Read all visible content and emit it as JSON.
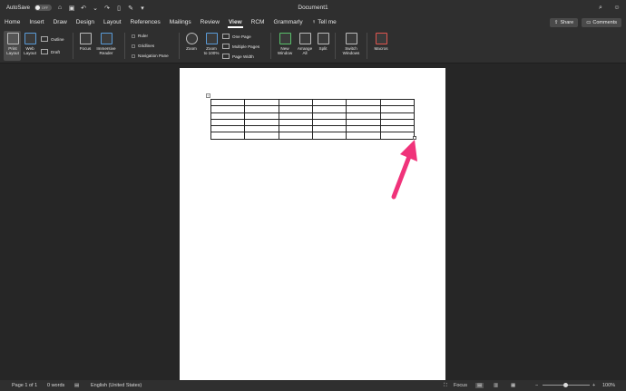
{
  "titlebar": {
    "autosave_label": "AutoSave",
    "autosave_state": "OFF",
    "document_title": "Document1"
  },
  "tabs": [
    "Home",
    "Insert",
    "Draw",
    "Design",
    "Layout",
    "References",
    "Mailings",
    "Review",
    "View",
    "RCM",
    "Grammarly"
  ],
  "active_tab": "View",
  "tell_me": "Tell me",
  "share_label": "Share",
  "comments_label": "Comments",
  "ribbon": {
    "print_layout": [
      "Print",
      "Layout"
    ],
    "web_layout": [
      "Web",
      "Layout"
    ],
    "outline": "Outline",
    "draft": "Draft",
    "focus": "Focus",
    "immersive_reader": [
      "Immersive",
      "Reader"
    ],
    "ruler": "Ruler",
    "gridlines": "Gridlines",
    "navigation_pane": "Navigation Pane",
    "zoom": "Zoom",
    "zoom_100": [
      "Zoom",
      "to 100%"
    ],
    "one_page": "One Page",
    "multiple_pages": "Multiple Pages",
    "page_width": "Page Width",
    "new_window": [
      "New",
      "Window"
    ],
    "arrange_all": [
      "Arrange",
      "All"
    ],
    "split": "Split",
    "switch_windows": [
      "Switch",
      "Windows"
    ],
    "macros": "Macros"
  },
  "table": {
    "rows": 6,
    "cols": 6
  },
  "status": {
    "page": "Page 1 of 1",
    "words": "0 words",
    "language": "English (United States)",
    "focus": "Focus",
    "zoom": "100%"
  },
  "annotation_color": "#f0337a"
}
